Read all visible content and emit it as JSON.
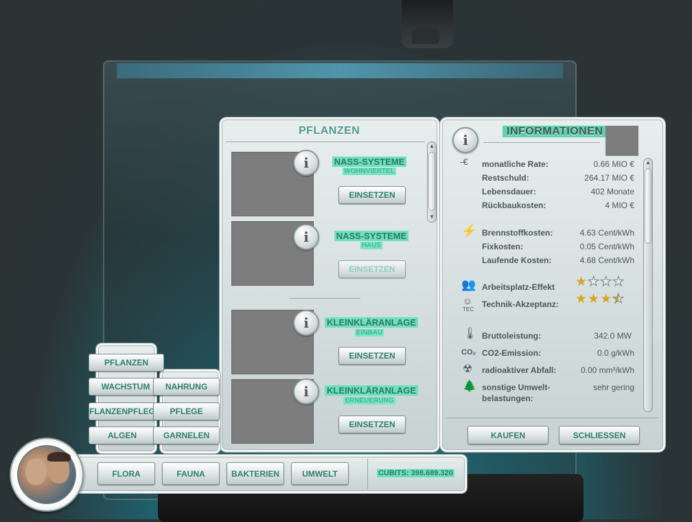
{
  "plants_panel": {
    "title": "PFLANZEN",
    "items": [
      {
        "title": "NASS-SYSTEME",
        "subtitle": "WOHNVIERTEL",
        "button": "EINSETZEN",
        "enabled": true
      },
      {
        "title": "NASS-SYSTEME",
        "subtitle": "HAUS",
        "button": "EINSETZEN",
        "enabled": false
      },
      {
        "title": "KLEINKLÄRANLAGE",
        "subtitle": "EINBAU",
        "button": "EINSETZEN",
        "enabled": true
      },
      {
        "title": "KLEINKLÄRANLAGE",
        "subtitle": "ERNEUERUNG",
        "button": "EINSETZEN",
        "enabled": true
      }
    ]
  },
  "info_panel": {
    "title": "INFORMATIONEN",
    "costs": [
      {
        "label": "monatliche Rate:",
        "value": "0.66 MIO €"
      },
      {
        "label": "Restschuld:",
        "value": "264.17 MIO €"
      },
      {
        "label": "Lebensdauer:",
        "value": "402 Monate"
      },
      {
        "label": "Rückbaukosten:",
        "value": "4 MIO €"
      }
    ],
    "energy": [
      {
        "label": "Brennstoffkosten:",
        "value": "4.63 Cent/kWh"
      },
      {
        "label": "Fixkosten:",
        "value": "0.05 Cent/kWh"
      },
      {
        "label": "Laufende Kosten:",
        "value": "4.68 Cent/kWh"
      }
    ],
    "ratings": [
      {
        "label": "Arbeitsplatz-Effekt",
        "stars": 1,
        "max": 4
      },
      {
        "label": "Technik-Akzeptanz:",
        "stars": 3.5,
        "max": 4
      }
    ],
    "tec_label": "TEC",
    "co2_label": "CO₂",
    "environment": [
      {
        "label": "Bruttoleistung:",
        "value": "342.0 MW"
      },
      {
        "label": "CO2-Emission:",
        "value": "0.0 g/kWh"
      },
      {
        "label": "radioaktiver Abfall:",
        "value": "0.00 mm³/kWh"
      },
      {
        "label": "sonstige Umwelt-",
        "label2": "belastungen:",
        "value": "sehr gering"
      }
    ],
    "buy_button": "KAUFEN",
    "close_button": "SCHLIESSEN"
  },
  "side_menu": {
    "buttons": [
      "PFLANZEN",
      "WACHSTUM",
      "PFLANZENPFLEGE",
      "ALGEN"
    ],
    "buttons_right": [
      "NAHRUNG",
      "PFLEGE",
      "GARNELEN"
    ]
  },
  "bottom_bar": {
    "tabs": [
      "FLORA",
      "FAUNA",
      "BAKTERIEN",
      "UMWELT"
    ],
    "cubits": "CUBITS: 398.689.320"
  },
  "colors": {
    "accent": "#38a38c",
    "highlight": "#6ee0bd",
    "star": "#d7a425"
  }
}
